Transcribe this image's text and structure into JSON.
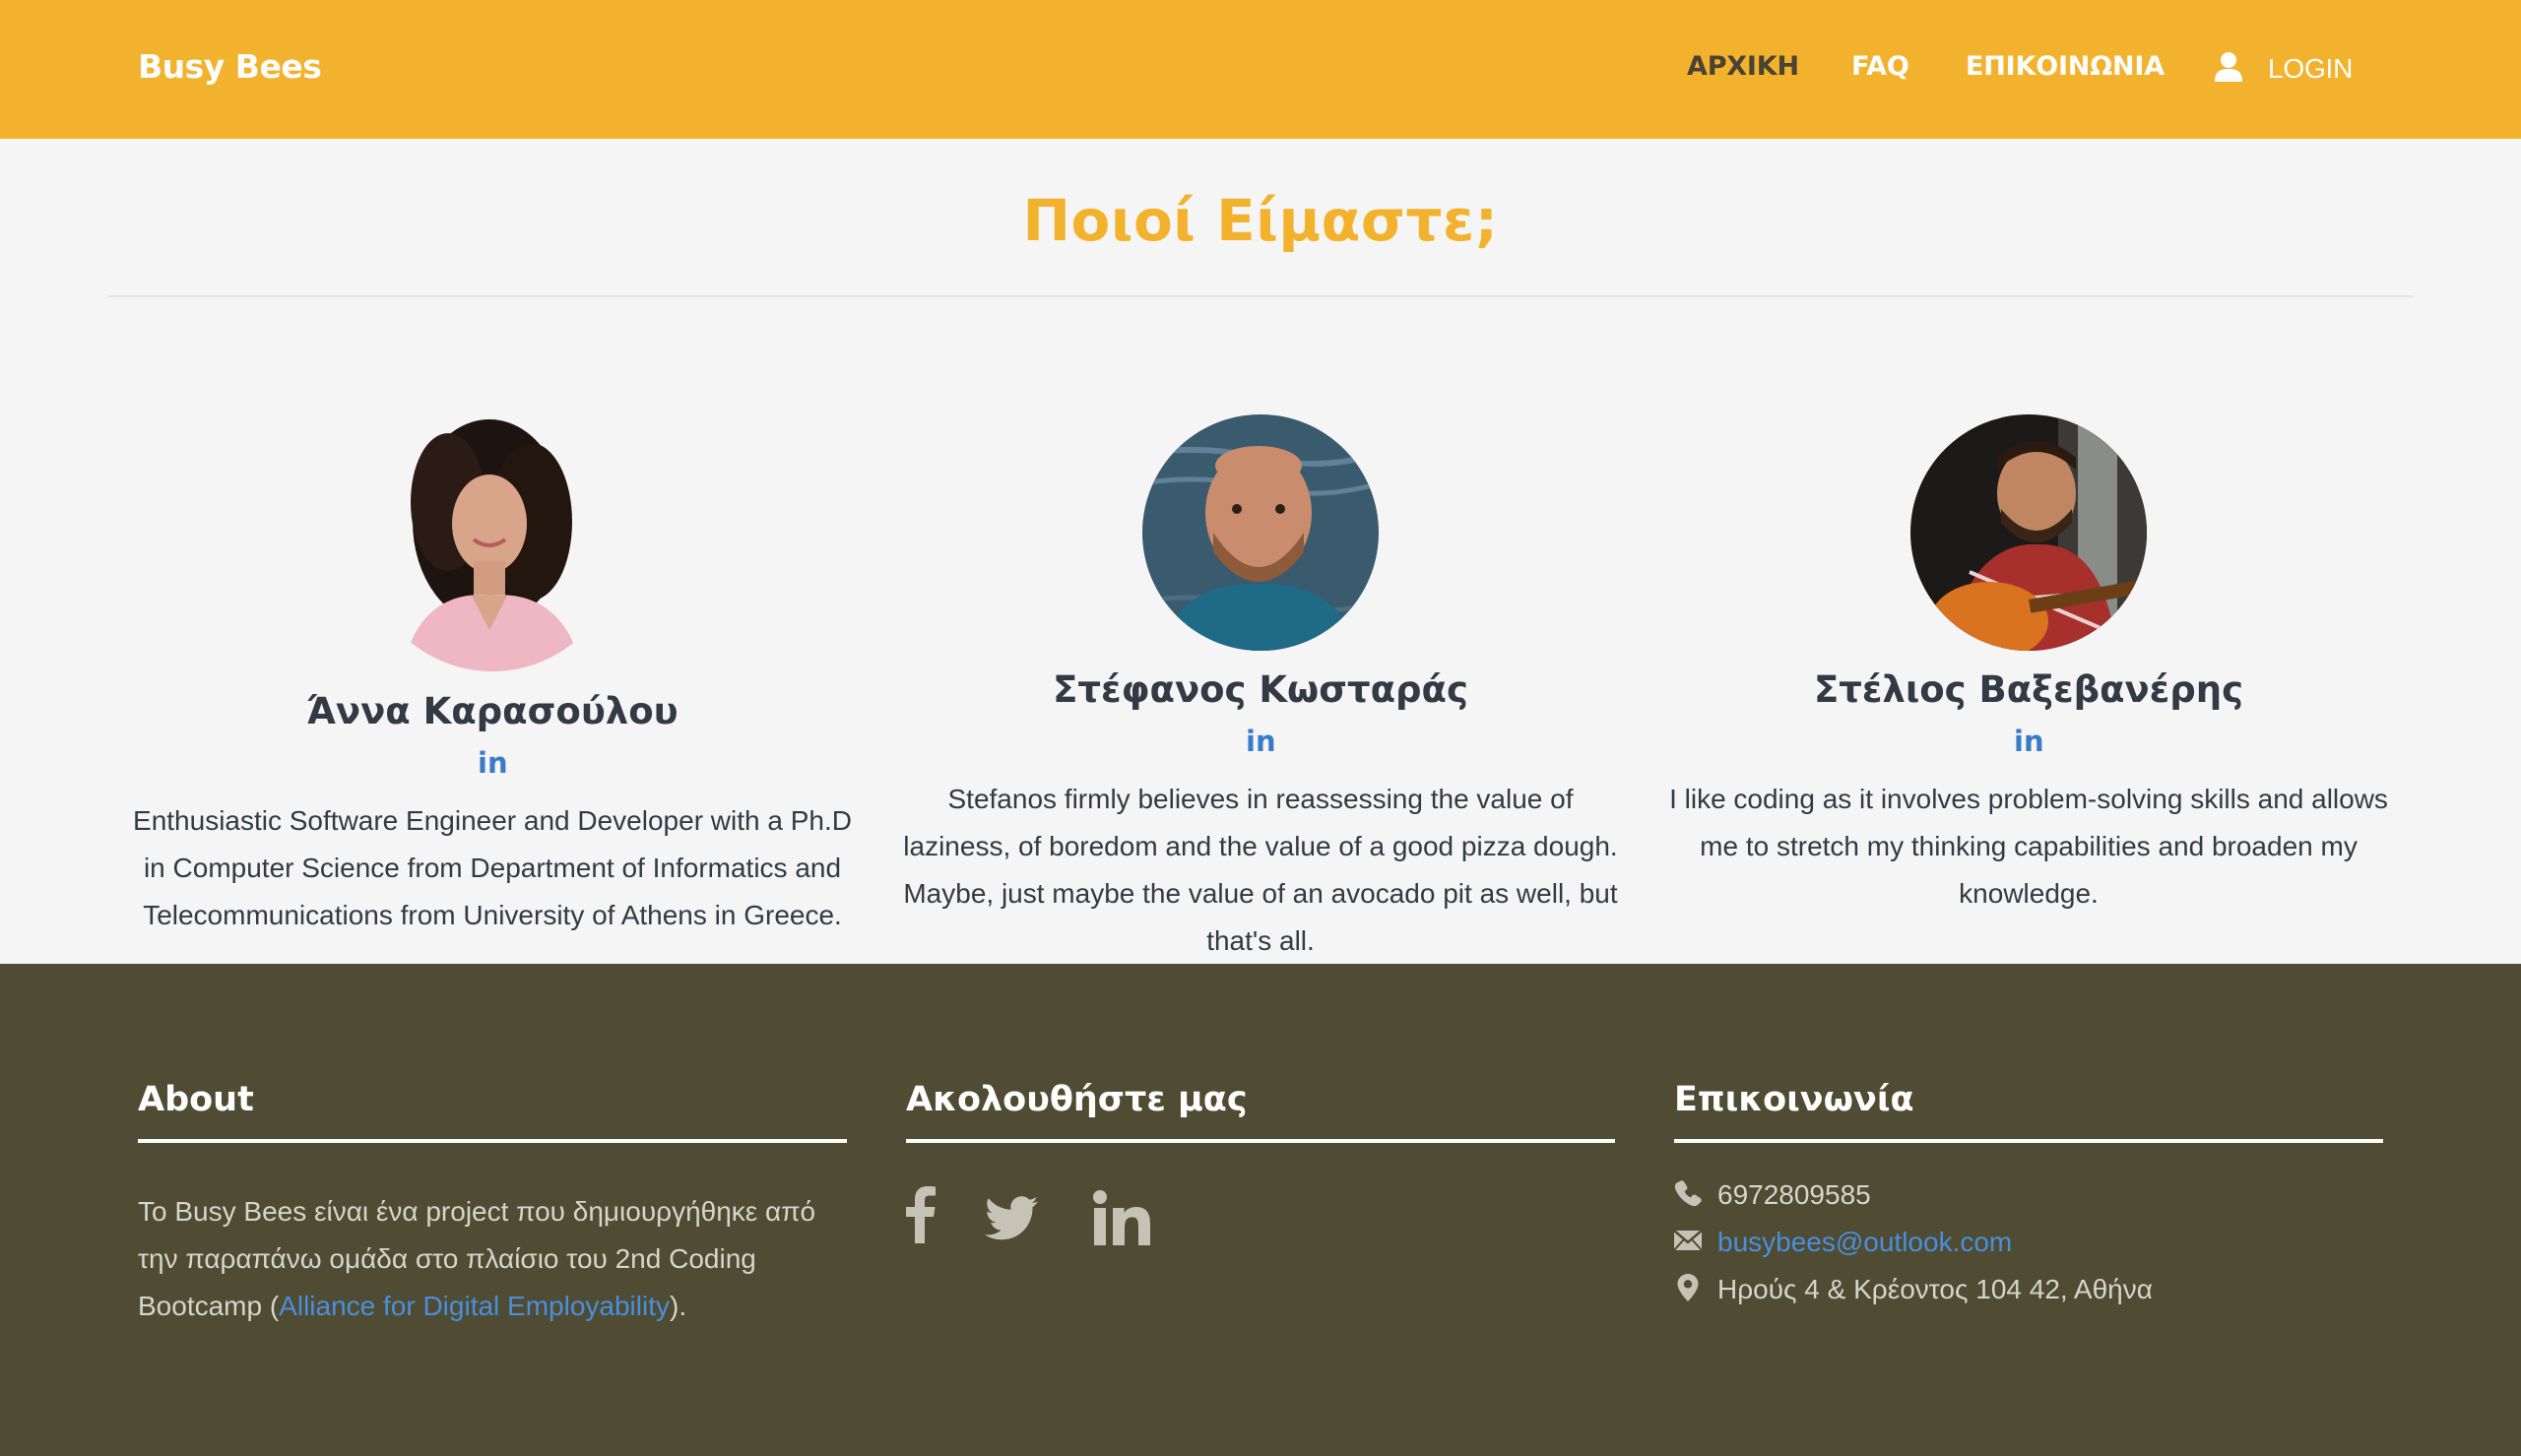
{
  "navbar": {
    "brand": "Busy Bees",
    "items": [
      "ΑΡΧΙΚΗ",
      "FAQ",
      "ΕΠΙΚΟΙΝΩΝΙΑ"
    ],
    "login_label": "LOGIN",
    "login_icon": "user-icon",
    "background": "#f3b22d"
  },
  "header": {
    "title": "Ποιοί Είμαστε;"
  },
  "team": [
    {
      "name": "Άννα Καρασούλου",
      "linkedin": "in",
      "bio": "Enthusiastic Software Engineer and Developer with a Ph.D in Computer Science from Department of Informatics and Telecommunications from University of Athens in Greece."
    },
    {
      "name": "Στέφανος Κωσταράς",
      "linkedin": "in",
      "bio": "Stefanos firmly believes in reassessing the value of laziness, of boredom and the value of a good pizza dough. Maybe, just maybe the value of an avocado pit as well, but that's all."
    },
    {
      "name": "Στέλιος Βαξεβανέρης",
      "linkedin": "in",
      "bio": "I like coding as it involves problem-solving skills and allows me to stretch my thinking capabilities and broaden my knowledge."
    }
  ],
  "footer": {
    "about": {
      "heading": "About",
      "text_before": "Το Busy Bees είναι ένα project που δημιουργήθηκε από την παραπάνω ομάδα στο πλαίσιο του 2nd Coding Bootcamp (",
      "link": "Alliance for Digital Employability",
      "text_after": ")."
    },
    "follow": {
      "heading": "Ακολουθήστε μας",
      "icons": [
        "facebook-icon",
        "twitter-icon",
        "linkedin-icon"
      ]
    },
    "contact": {
      "heading": "Επικοινωνία",
      "phone": "6972809585",
      "email": "busybees@outlook.com",
      "address": "Ηρούς 4 & Κρέοντος 104 42, Αθήνα"
    },
    "background": "#4f4c33"
  },
  "colors": {
    "accent": "#f3b22d",
    "link": "#4a8fdc",
    "text_dark": "#333a44"
  }
}
